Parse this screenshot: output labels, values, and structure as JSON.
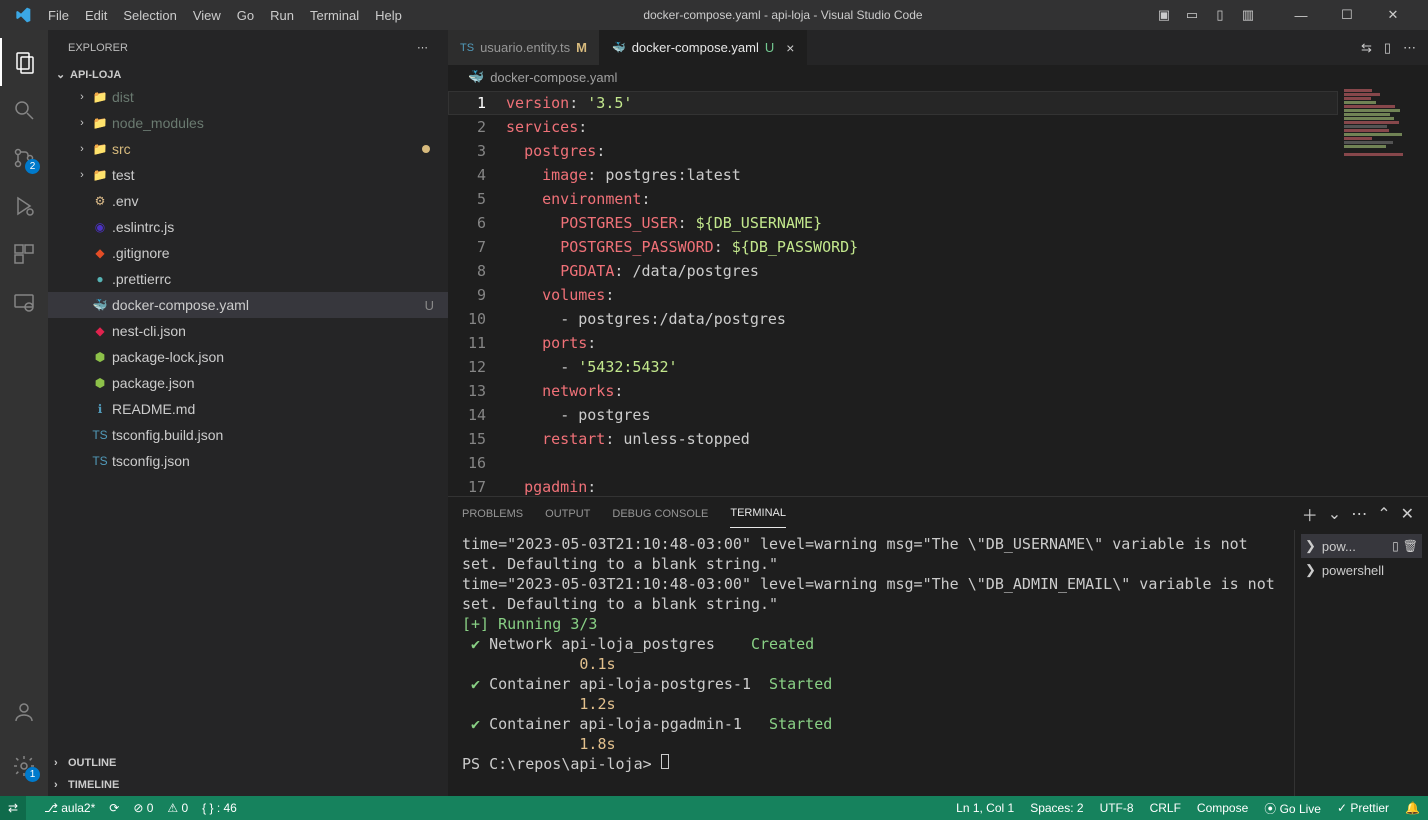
{
  "menu": [
    "File",
    "Edit",
    "Selection",
    "View",
    "Go",
    "Run",
    "Terminal",
    "Help"
  ],
  "windowTitle": "docker-compose.yaml - api-loja - Visual Studio Code",
  "explorer": {
    "title": "EXPLORER",
    "project": "API-LOJA"
  },
  "tree": [
    {
      "chev": "›",
      "icon": "📁",
      "iconColor": "#e06c75",
      "label": "dist",
      "dim": true
    },
    {
      "chev": "›",
      "icon": "📁",
      "iconColor": "#8dc149",
      "label": "node_modules",
      "dim": true
    },
    {
      "chev": "›",
      "icon": "📁",
      "iconColor": "#8dc149",
      "label": "src",
      "mod": true,
      "dot": true
    },
    {
      "chev": "›",
      "icon": "📁",
      "iconColor": "#519aba",
      "label": "test"
    },
    {
      "chev": "",
      "icon": "⚙",
      "iconColor": "#e2c08d",
      "label": ".env"
    },
    {
      "chev": "",
      "icon": "◉",
      "iconColor": "#4b32c3",
      "label": ".eslintrc.js"
    },
    {
      "chev": "",
      "icon": "◆",
      "iconColor": "#e44d26",
      "label": ".gitignore"
    },
    {
      "chev": "",
      "icon": "●",
      "iconColor": "#56b3b4",
      "label": ".prettierrc"
    },
    {
      "chev": "",
      "icon": "🐳",
      "iconColor": "#0db7ed",
      "label": "docker-compose.yaml",
      "selected": true,
      "status": "U"
    },
    {
      "chev": "",
      "icon": "◆",
      "iconColor": "#e0234e",
      "label": "nest-cli.json"
    },
    {
      "chev": "",
      "icon": "⬢",
      "iconColor": "#8dc149",
      "label": "package-lock.json"
    },
    {
      "chev": "",
      "icon": "⬢",
      "iconColor": "#8dc149",
      "label": "package.json"
    },
    {
      "chev": "",
      "icon": "ℹ",
      "iconColor": "#519aba",
      "label": "README.md"
    },
    {
      "chev": "",
      "icon": "TS",
      "iconColor": "#519aba",
      "label": "tsconfig.build.json"
    },
    {
      "chev": "",
      "icon": "TS",
      "iconColor": "#519aba",
      "label": "tsconfig.json"
    }
  ],
  "outline": "OUTLINE",
  "timeline": "TIMELINE",
  "tabs": [
    {
      "icon": "TS",
      "iconColor": "#519aba",
      "label": "usuario.entity.ts",
      "status": "M",
      "statusClass": "mstatus",
      "active": false
    },
    {
      "icon": "🐳",
      "iconColor": "#0db7ed",
      "label": "docker-compose.yaml",
      "status": "U",
      "statusClass": "ustatus",
      "active": true,
      "close": true
    }
  ],
  "breadcrumb": {
    "icon": "🐳",
    "label": "docker-compose.yaml"
  },
  "code": {
    "lines": [
      [
        [
          "key",
          "version"
        ],
        [
          "punc",
          ": "
        ],
        [
          "str",
          "'3.5'"
        ]
      ],
      [
        [
          "key",
          "services"
        ],
        [
          "punc",
          ":"
        ]
      ],
      [
        [
          "ind",
          1
        ],
        [
          "key",
          "postgres"
        ],
        [
          "punc",
          ":"
        ]
      ],
      [
        [
          "ind",
          2
        ],
        [
          "key",
          "image"
        ],
        [
          "punc",
          ": "
        ],
        [
          "val",
          "postgres:latest"
        ]
      ],
      [
        [
          "ind",
          2
        ],
        [
          "key",
          "environment"
        ],
        [
          "punc",
          ":"
        ]
      ],
      [
        [
          "ind",
          3
        ],
        [
          "key",
          "POSTGRES_USER"
        ],
        [
          "punc",
          ": "
        ],
        [
          "var",
          "${DB_USERNAME}"
        ]
      ],
      [
        [
          "ind",
          3
        ],
        [
          "key",
          "POSTGRES_PASSWORD"
        ],
        [
          "punc",
          ": "
        ],
        [
          "var",
          "${DB_PASSWORD}"
        ]
      ],
      [
        [
          "ind",
          3
        ],
        [
          "key",
          "PGDATA"
        ],
        [
          "punc",
          ": "
        ],
        [
          "val",
          "/data/postgres"
        ]
      ],
      [
        [
          "ind",
          2
        ],
        [
          "key",
          "volumes"
        ],
        [
          "punc",
          ":"
        ]
      ],
      [
        [
          "ind",
          3
        ],
        [
          "punc",
          "- "
        ],
        [
          "val",
          "postgres:/data/postgres"
        ]
      ],
      [
        [
          "ind",
          2
        ],
        [
          "key",
          "ports"
        ],
        [
          "punc",
          ":"
        ]
      ],
      [
        [
          "ind",
          3
        ],
        [
          "punc",
          "- "
        ],
        [
          "str",
          "'5432:5432'"
        ]
      ],
      [
        [
          "ind",
          2
        ],
        [
          "key",
          "networks"
        ],
        [
          "punc",
          ":"
        ]
      ],
      [
        [
          "ind",
          3
        ],
        [
          "punc",
          "- "
        ],
        [
          "val",
          "postgres"
        ]
      ],
      [
        [
          "ind",
          2
        ],
        [
          "key",
          "restart"
        ],
        [
          "punc",
          ": "
        ],
        [
          "val",
          "unless-stopped"
        ]
      ],
      [],
      [
        [
          "ind",
          1
        ],
        [
          "key",
          "pgadmin"
        ],
        [
          "punc",
          ":"
        ]
      ]
    ]
  },
  "panel": {
    "tabs": [
      "PROBLEMS",
      "OUTPUT",
      "DEBUG CONSOLE",
      "TERMINAL"
    ],
    "activeTab": 3
  },
  "terminal": {
    "lines": [
      {
        "text": "time=\"2023-05-03T21:10:48-03:00\" level=warning msg=\"The \\\"DB_USERNAME\\\" variable is not set. Defaulting to a blank string.\""
      },
      {
        "text": "time=\"2023-05-03T21:10:48-03:00\" level=warning msg=\"The \\\"DB_ADMIN_EMAIL\\\" variable is not set. Defaulting to a blank string.\""
      },
      {
        "text": "[+] Running 3/3",
        "class": "t-green"
      },
      {
        "check": true,
        "text": " Network api-loja_postgres    ",
        "status": "Created"
      },
      {
        "text": "             0.1s",
        "class": "t-yellow"
      },
      {
        "check": true,
        "text": " Container api-loja-postgres-1  ",
        "status": "Started"
      },
      {
        "text": "             1.2s",
        "class": "t-yellow"
      },
      {
        "check": true,
        "text": " Container api-loja-pgadmin-1   ",
        "status": "Started"
      },
      {
        "text": "             1.8s",
        "class": "t-yellow"
      },
      {
        "prompt": "PS C:\\repos\\api-loja> "
      }
    ],
    "entries": [
      {
        "label": "pow...",
        "active": true,
        "icons": true
      },
      {
        "label": "powershell"
      }
    ]
  },
  "statusbar": {
    "branch": "aula2*",
    "sync": "⟳",
    "errors": "⊘ 0",
    "warnings": "⚠ 0",
    "brackets": "{ } : 46",
    "pos": "Ln 1, Col 1",
    "spaces": "Spaces: 2",
    "enc": "UTF-8",
    "eol": "CRLF",
    "lang": "Compose",
    "golive": "⦿ Go Live",
    "prettier": "✓ Prettier",
    "bell": "🔔"
  },
  "activityBadges": {
    "scm": "2",
    "settings": "1"
  }
}
